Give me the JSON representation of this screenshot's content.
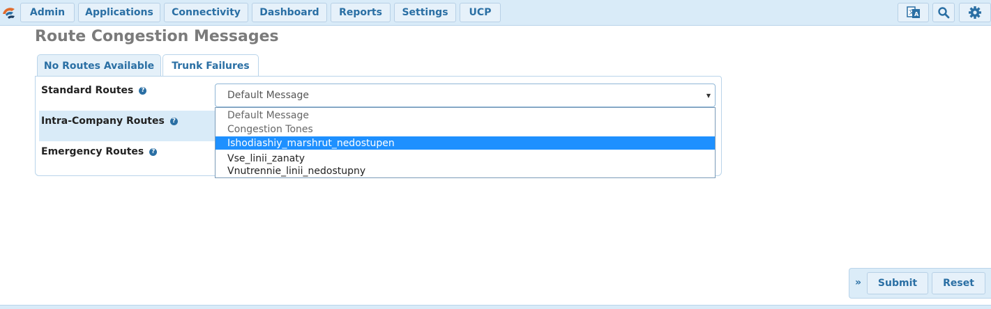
{
  "nav": {
    "items": [
      "Admin",
      "Applications",
      "Connectivity",
      "Dashboard",
      "Reports",
      "Settings",
      "UCP"
    ]
  },
  "page": {
    "title": "Route Congestion Messages"
  },
  "tabs": [
    {
      "label": "No Routes Available",
      "active": true
    },
    {
      "label": "Trunk Failures",
      "active": false
    }
  ],
  "form": {
    "rows": [
      {
        "label": "Standard Routes"
      },
      {
        "label": "Intra-Company Routes"
      },
      {
        "label": "Emergency Routes"
      }
    ],
    "help_glyph": "?",
    "select": {
      "value": "Default Message",
      "caret": "▼",
      "options": [
        "Default Message",
        "Congestion Tones",
        "Ishodiashiy_marshrut_nedostupen",
        "Vse_linii_zanaty",
        "Vnutrennie_linii_nedostupny"
      ],
      "highlighted_index": 2
    }
  },
  "actions": {
    "expand_glyph": "»",
    "submit_label": "Submit",
    "reset_label": "Reset"
  },
  "colors": {
    "nav_bg": "#d9ebf8",
    "accent": "#2a6fa4",
    "highlight": "#1e90ff",
    "title": "#7b7b7b"
  }
}
